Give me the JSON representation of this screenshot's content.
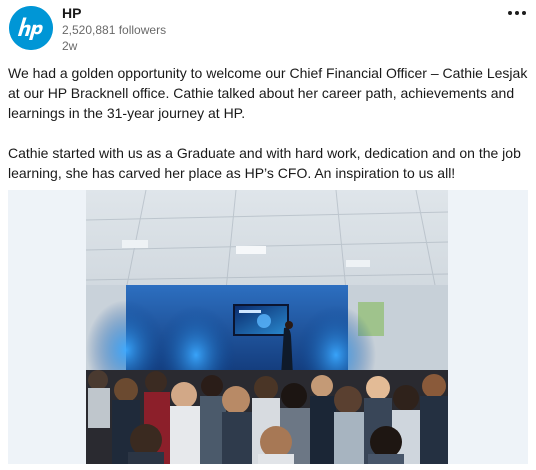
{
  "post": {
    "actor": {
      "name": "HP",
      "followers": "2,520,881 followers",
      "timestamp": "2w",
      "logo_icon": "hp-logo-icon",
      "logo_color": "#0096d6"
    },
    "menu_icon": "overflow-menu-icon",
    "commentary": {
      "paragraph_1": "We had a golden opportunity to welcome our Chief Financial Officer – Cathie Lesjak at our HP Bracknell office. Cathie talked about her career path, achievements and learnings in the 31-year journey at HP.",
      "paragraph_2": "Cathie started with us as a Graduate and with hard work, dedication and on the job learning, she has carved her place as HP’s CFO. An inspiration to us all!"
    },
    "media": {
      "image_icon": "event-photo-image",
      "background_color": "#eef3f8",
      "stage_light_color": "#1e8ff5"
    }
  }
}
